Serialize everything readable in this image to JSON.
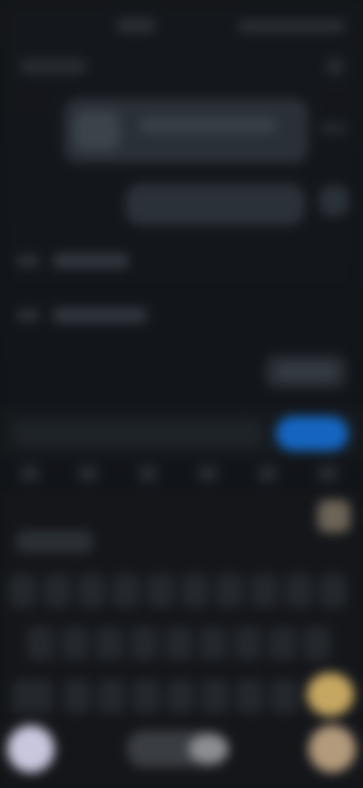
{
  "screen": {
    "description_visible_text": "",
    "status_bar": {
      "time": "",
      "system_icons": ""
    },
    "header": {
      "back_label": "",
      "more_icon": "more-icon"
    },
    "messages": [
      {
        "text": ""
      },
      {
        "text": ""
      }
    ],
    "options": [
      {
        "label": ""
      },
      {
        "label": ""
      }
    ],
    "reply_pill": {
      "label": ""
    },
    "composer": {
      "placeholder": "",
      "send_label": ""
    },
    "keyboard": {
      "label": ""
    },
    "colors": {
      "send_button": "#1565c0",
      "mic_button": "#c9c7dd",
      "enter_button": "#b39a7c"
    }
  }
}
